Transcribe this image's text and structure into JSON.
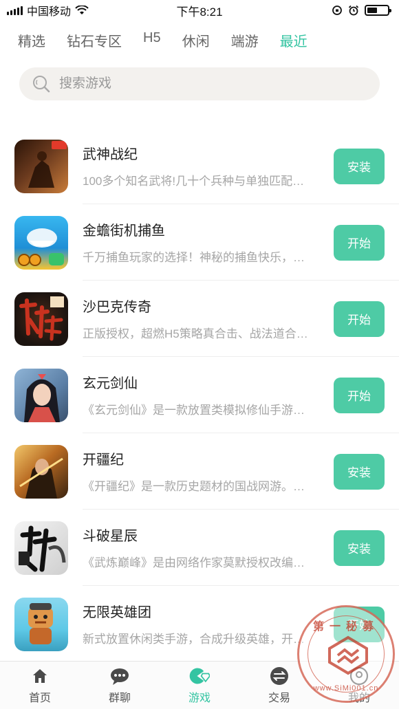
{
  "status_bar": {
    "carrier": "中国移动",
    "time": "下午8:21"
  },
  "tabs": [
    {
      "label": "精选",
      "active": false
    },
    {
      "label": "钻石专区",
      "active": false
    },
    {
      "label": "H5",
      "active": false
    },
    {
      "label": "休闲",
      "active": false
    },
    {
      "label": "端游",
      "active": false
    },
    {
      "label": "最近",
      "active": true
    }
  ],
  "search": {
    "placeholder": "搜索游戏",
    "icon": "search-icon"
  },
  "games": [
    {
      "name": "武神战纪",
      "description": "100多个知名武将!几十个兵种与单独匹配…",
      "button": "安装",
      "icon_colors": [
        "#6b3a1e",
        "#c97c3a"
      ]
    },
    {
      "name": "金蟾街机捕鱼",
      "description": "千万捕鱼玩家的选择！神秘的捕鱼快乐，…",
      "button": "开始",
      "icon_colors": [
        "#2aa6e8",
        "#f7c531"
      ]
    },
    {
      "name": "沙巴克传奇",
      "description": "正版授权，超燃H5策略真合击、战法道合…",
      "button": "开始",
      "icon_colors": [
        "#1c1410",
        "#b3281c"
      ]
    },
    {
      "name": "玄元剑仙",
      "description": "《玄元剑仙》是一款放置类模拟修仙手游…",
      "button": "开始",
      "icon_colors": [
        "#5b7fa6",
        "#d8514a"
      ]
    },
    {
      "name": "开疆纪",
      "description": "《开疆纪》是一款历史题材的国战网游。…",
      "button": "安装",
      "icon_colors": [
        "#3b2410",
        "#e0a040"
      ]
    },
    {
      "name": "斗破星辰",
      "description": "《武炼巅峰》是由网络作家莫默授权改编…",
      "button": "安装",
      "icon_colors": [
        "#e9e9e9",
        "#222222"
      ]
    },
    {
      "name": "无限英雄团",
      "description": "新式放置休闲类手游，合成升级英雄，开…",
      "button": "开始",
      "icon_colors": [
        "#5ec8e6",
        "#e0974a"
      ]
    }
  ],
  "bottom_nav": [
    {
      "label": "首页",
      "icon": "home-icon",
      "active": false
    },
    {
      "label": "群聊",
      "icon": "chat-icon",
      "active": false
    },
    {
      "label": "游戏",
      "icon": "game-icon",
      "active": true
    },
    {
      "label": "交易",
      "icon": "trade-icon",
      "active": false
    },
    {
      "label": "我的",
      "icon": "profile-icon",
      "active": false
    }
  ],
  "watermark": {
    "top_text": "第一秘募",
    "bottom_text": "www.SiMi001.cn"
  },
  "colors": {
    "accent": "#34c4a2",
    "button": "#4ecba5"
  }
}
